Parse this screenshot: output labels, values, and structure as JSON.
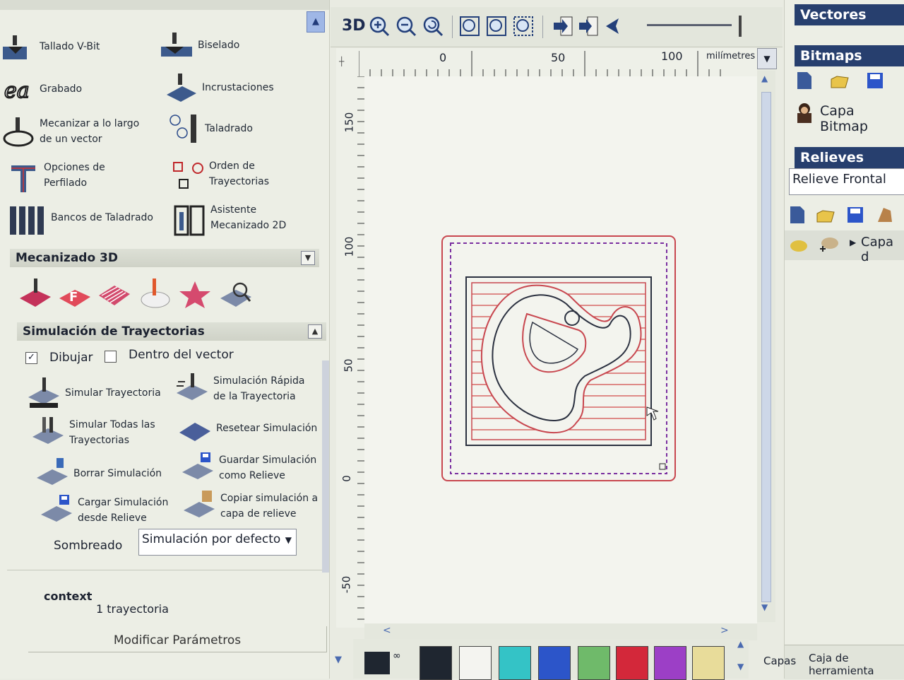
{
  "left_panel": {
    "tools_2d": [
      {
        "name": "tallado-v-bit",
        "label": "Tallado V-Bit"
      },
      {
        "name": "biselado",
        "label": "Biselado"
      },
      {
        "name": "grabado",
        "label": "Grabado"
      },
      {
        "name": "incrustaciones",
        "label": "Incrustaciones"
      },
      {
        "name": "mecanizar-vector",
        "label": "Mecanizar a lo largo\nde un vector"
      },
      {
        "name": "taladrado",
        "label": "Taladrado"
      },
      {
        "name": "opciones-perfilado",
        "label": "Opciones de\nPerfilado"
      },
      {
        "name": "orden-trayectorias",
        "label": "Orden de\nTrayectorias"
      },
      {
        "name": "bancos-taladrado",
        "label": "Bancos de Taladrado"
      },
      {
        "name": "asistente-2d",
        "label": "Asistente\nMecanizado 2D"
      }
    ],
    "section_3d": {
      "title": "Mecanizado 3D"
    },
    "section_sim": {
      "title": "Simulación de Trayectorias"
    },
    "dibujar_label": "Dibujar",
    "dentro_label": "Dentro del vector",
    "sim_tools": [
      {
        "name": "simular-trayectoria",
        "label": "Simular Trayectoria"
      },
      {
        "name": "simulacion-rapida",
        "label": "Simulación Rápida\nde la Trayectoria"
      },
      {
        "name": "simular-todas",
        "label": "Simular Todas las\nTrayectorias"
      },
      {
        "name": "resetear-simulacion",
        "label": "Resetear Simulación"
      },
      {
        "name": "borrar-simulacion",
        "label": "Borrar Simulación"
      },
      {
        "name": "guardar-simulacion",
        "label": "Guardar Simulación\ncomo Relieve"
      },
      {
        "name": "cargar-simulacion",
        "label": "Cargar Simulación\ndesde Relieve"
      },
      {
        "name": "copiar-simulacion",
        "label": "Copiar simulación a\ncapa de relieve"
      }
    ],
    "sombreado_label": "Sombreado",
    "sombreado_value": "Simulación por defecto",
    "context_label": "context",
    "trayectoria_count": "1 trayectoria",
    "modificar_label": "Modificar Parámetros"
  },
  "toolbar": {
    "view3d_label": "3D",
    "units_label": "milímetres"
  },
  "rulers": {
    "top_ticks": [
      "0",
      "50",
      "100"
    ],
    "left_ticks": [
      "150",
      "100",
      "50",
      "0",
      "-50"
    ]
  },
  "palette": {
    "colors": [
      "#1f2630",
      "#f4f4f0",
      "#34c3c6",
      "#2c55c9",
      "#6fba6a",
      "#d3283a",
      "#9c3fc6",
      "#e8dc9a"
    ]
  },
  "right_panel": {
    "vectores_title": "Vectores",
    "bitmaps_title": "Bitmaps",
    "capa_bitmap_label": "Capa Bitmap",
    "relieves_title": "Relieves",
    "relieve_value": "Relieve Frontal",
    "capa_label": "Capa d",
    "capas_tab": "Capas",
    "caja_tab": "Caja de herramienta"
  }
}
